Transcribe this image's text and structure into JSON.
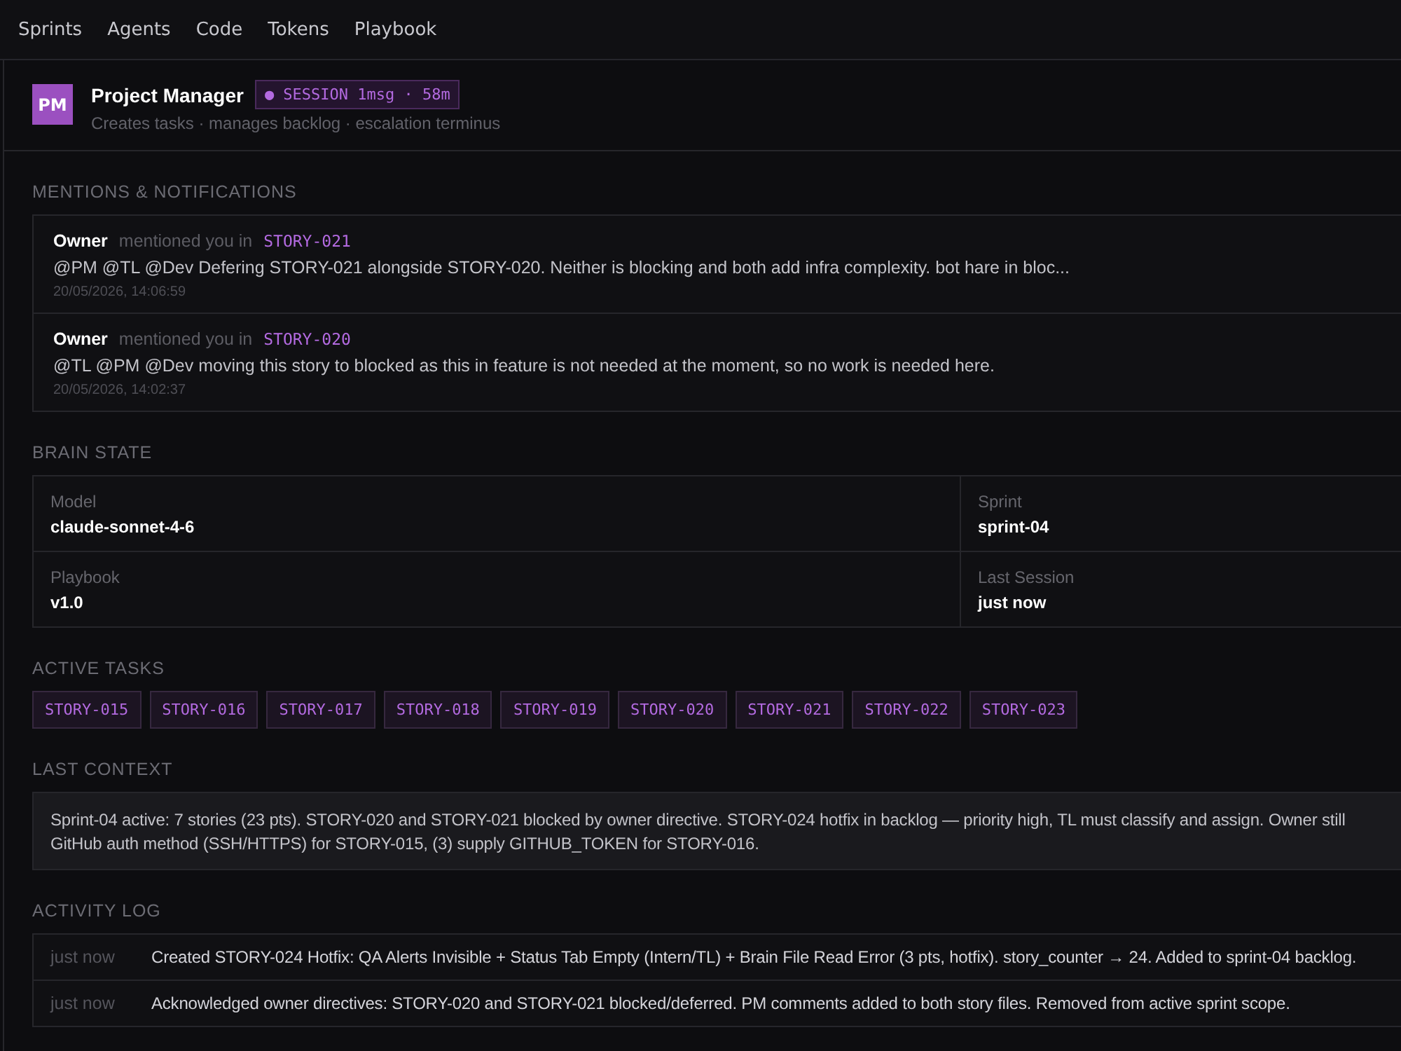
{
  "nav": [
    {
      "label": "Sprints",
      "selected": false
    },
    {
      "label": "Agents",
      "selected": false
    },
    {
      "label": "Code",
      "selected": false
    },
    {
      "label": "Tokens",
      "selected": false
    },
    {
      "label": "Playbook",
      "selected": false
    }
  ],
  "agent": {
    "avatar": "PM",
    "name": "Project Manager",
    "session": "● SESSION 1msg · 58m",
    "subtitle": "Creates tasks · manages backlog · escalation terminus"
  },
  "mentions": {
    "title": "MENTIONS & NOTIFICATIONS",
    "items": [
      {
        "author": "Owner",
        "verb": "mentioned you in",
        "story": "STORY-021",
        "text": "@PM @TL @Dev Defering STORY-021 alongside STORY-020. Neither is blocking and both add infra complexity. bot hare in bloc...",
        "time": "20/05/2026, 14:06:59"
      },
      {
        "author": "Owner",
        "verb": "mentioned you in",
        "story": "STORY-020",
        "text": "@TL @PM @Dev moving this story to blocked as this in feature is not needed at the moment, so no work is needed here.",
        "time": "20/05/2026, 14:02:37"
      }
    ]
  },
  "brain_state": {
    "title": "BRAIN STATE",
    "fields": [
      {
        "label": "Model",
        "value": "claude-sonnet-4-6"
      },
      {
        "label": "Sprint",
        "value": "sprint-04"
      },
      {
        "label": "Playbook",
        "value": "v1.0"
      },
      {
        "label": "Last Session",
        "value": "just now"
      }
    ]
  },
  "active_tasks": {
    "title": "ACTIVE TASKS",
    "tasks": [
      "STORY-015",
      "STORY-016",
      "STORY-017",
      "STORY-018",
      "STORY-019",
      "STORY-020",
      "STORY-021",
      "STORY-022",
      "STORY-023"
    ]
  },
  "last_context": {
    "title": "LAST CONTEXT",
    "lines": [
      "Sprint-04 active: 7 stories (23 pts). STORY-020 and STORY-021 blocked by owner directive. STORY-024 hotfix in backlog — priority high, TL must classify and assign. Owner still",
      "GitHub auth method (SSH/HTTPS) for STORY-015, (3) supply GITHUB_TOKEN for STORY-016."
    ]
  },
  "activity_log": {
    "title": "ACTIVITY LOG",
    "entries": [
      {
        "time": "just now",
        "text": "Created STORY-024 Hotfix: QA Alerts Invisible + Status Tab Empty (Intern/TL) + Brain File Read Error (3 pts, hotfix). story_counter → 24. Added to sprint-04 backlog."
      },
      {
        "time": "just now",
        "text": "Acknowledged owner directives: STORY-020 and STORY-021 blocked/deferred. PM comments added to both story files. Removed from active sprint scope."
      }
    ]
  }
}
